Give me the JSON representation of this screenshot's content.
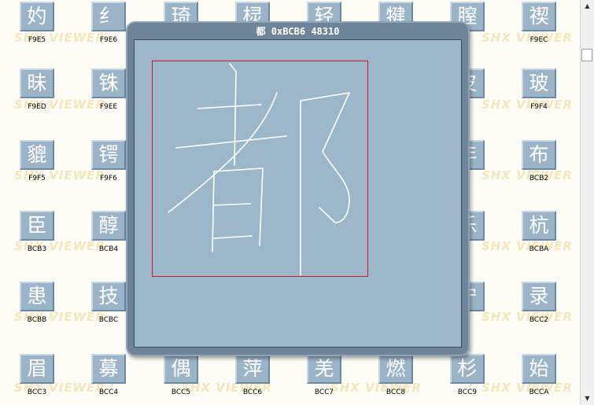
{
  "popup": {
    "title": "都 0xBCB6 48310",
    "character": "都",
    "code": "BCB6",
    "number": "48310"
  },
  "watermark_text": "SHX VIEWER",
  "grid": {
    "rows": [
      [
        {
          "ch": "妁",
          "code": "F9E5"
        },
        {
          "ch": "纟",
          "code": "F9E6"
        },
        {
          "ch": "琦",
          "code": ""
        },
        {
          "ch": "棂",
          "code": ""
        },
        {
          "ch": "轻",
          "code": ""
        },
        {
          "ch": "犍",
          "code": ""
        },
        {
          "ch": "膣",
          "code": "B"
        },
        {
          "ch": "禊",
          "code": "F9EC"
        }
      ],
      [
        {
          "ch": "昧",
          "code": "F9ED"
        },
        {
          "ch": "铢",
          "code": "F9EE"
        },
        {
          "ch": "",
          "code": ""
        },
        {
          "ch": "",
          "code": ""
        },
        {
          "ch": "",
          "code": ""
        },
        {
          "ch": "",
          "code": ""
        },
        {
          "ch": "皮",
          "code": "3"
        },
        {
          "ch": "玻",
          "code": "F9F4"
        }
      ],
      [
        {
          "ch": "貔",
          "code": "F9F5"
        },
        {
          "ch": "锷",
          "code": "F9F6"
        },
        {
          "ch": "",
          "code": ""
        },
        {
          "ch": "",
          "code": ""
        },
        {
          "ch": "",
          "code": ""
        },
        {
          "ch": "",
          "code": ""
        },
        {
          "ch": "年",
          "code": "1"
        },
        {
          "ch": "布",
          "code": "BCB2"
        }
      ],
      [
        {
          "ch": "臣",
          "code": "BCB3"
        },
        {
          "ch": "醇",
          "code": "BCB4"
        },
        {
          "ch": "",
          "code": ""
        },
        {
          "ch": "",
          "code": ""
        },
        {
          "ch": "",
          "code": ""
        },
        {
          "ch": "",
          "code": ""
        },
        {
          "ch": "乐",
          "code": "9"
        },
        {
          "ch": "杭",
          "code": "BCBA"
        }
      ],
      [
        {
          "ch": "患",
          "code": "BCBB"
        },
        {
          "ch": "技",
          "code": "BCBC"
        },
        {
          "ch": "",
          "code": ""
        },
        {
          "ch": "",
          "code": ""
        },
        {
          "ch": "",
          "code": ""
        },
        {
          "ch": "",
          "code": ""
        },
        {
          "ch": "宁",
          "code": "1"
        },
        {
          "ch": "录",
          "code": "BCC2"
        }
      ],
      [
        {
          "ch": "眉",
          "code": "BCC3"
        },
        {
          "ch": "募",
          "code": "BCC4"
        },
        {
          "ch": "偶",
          "code": "BCC5"
        },
        {
          "ch": "萍",
          "code": "BCC6"
        },
        {
          "ch": "羌",
          "code": "BCC7"
        },
        {
          "ch": "燃",
          "code": "BCC8"
        },
        {
          "ch": "杉",
          "code": "BCC9"
        },
        {
          "ch": "始",
          "code": "BCCA"
        }
      ]
    ]
  },
  "scrollbar": {
    "up_arrow": "▲",
    "down_arrow": "▼"
  },
  "colors": {
    "background": "#fdfdf5",
    "tile": "#9cb4c8",
    "popup_frame": "#6d8499",
    "popup_inner": "#9cb7c9",
    "glyph_box_border": "#d01818",
    "watermark": "#f0d28c"
  }
}
